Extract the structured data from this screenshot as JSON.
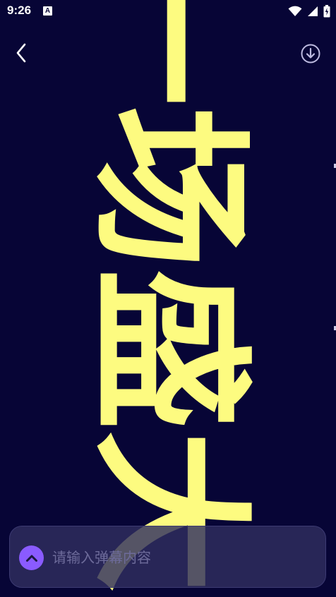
{
  "status_bar": {
    "time": "9:26",
    "notification_icon": "a-icon",
    "icons": [
      "wifi-icon",
      "cellular-signal-icon",
      "battery-icon"
    ]
  },
  "toolbar": {
    "back_icon": "chevron-left-icon",
    "download_icon": "download-circle-icon"
  },
  "danmaku": {
    "characters": [
      "一",
      "场",
      "盛",
      "大"
    ],
    "text_color": "#fdfb80",
    "background_color": "#070536"
  },
  "input_bar": {
    "expand_icon": "chevron-up-icon",
    "placeholder": "请输入弹幕内容",
    "value": ""
  },
  "colors": {
    "accent": "#8a5bff",
    "input_background": "#302e5f"
  }
}
